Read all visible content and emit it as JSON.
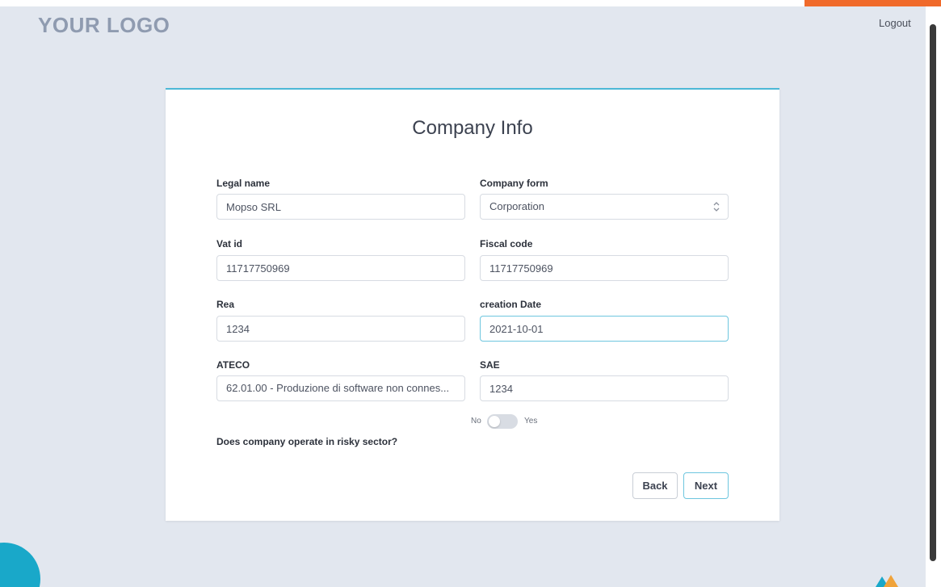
{
  "header": {
    "logo_text": "YOUR LOGO",
    "logout_label": "Logout"
  },
  "card": {
    "title": "Company Info"
  },
  "form": {
    "legal_name": {
      "label": "Legal name",
      "value": "Mopso SRL"
    },
    "company_form": {
      "label": "Company form",
      "value": "Corporation"
    },
    "vat_id": {
      "label": "Vat id",
      "value": "11717750969"
    },
    "fiscal_code": {
      "label": "Fiscal code",
      "value": "11717750969"
    },
    "rea": {
      "label": "Rea",
      "value": "1234"
    },
    "creation_date": {
      "label": "creation Date",
      "value": "2021-10-01"
    },
    "ateco": {
      "label": "ATECO",
      "value": "62.01.00 - Produzione di software non connes..."
    },
    "sae": {
      "label": "SAE",
      "value": "1234"
    },
    "risky_sector": {
      "question": "Does company operate in risky sector?",
      "no_label": "No",
      "yes_label": "Yes",
      "value": false
    }
  },
  "actions": {
    "back_label": "Back",
    "next_label": "Next"
  },
  "colors": {
    "background": "#e2e7ef",
    "accent_orange": "#f06a2b",
    "accent_teal": "#19a8c9",
    "card_top_border": "#4cb8d6",
    "focus_border": "#6ec6df"
  },
  "icons": {
    "company_form_select": "chevron-up-down-icon"
  }
}
